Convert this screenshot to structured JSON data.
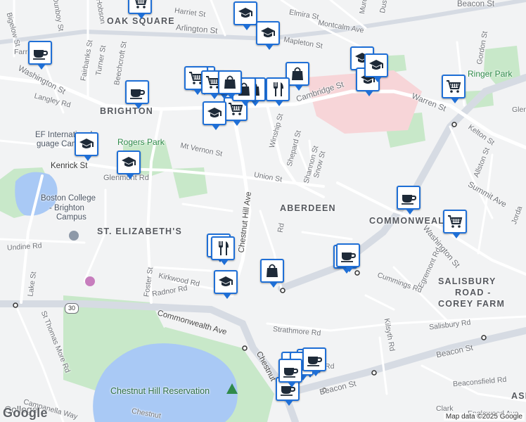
{
  "colors": {
    "marker_border": "#1f6fd6",
    "road": "#ffffff",
    "highway": "#d6dbe3",
    "park": "#c8e8c9",
    "water": "#a9c9f5",
    "hospital": "#f7d5d8"
  },
  "neighborhoods": [
    {
      "text": "OAK SQUARE"
    },
    {
      "text": "BRIGHTON"
    },
    {
      "text": "ST. ELIZABETH'S"
    },
    {
      "text": "ABERDEEN"
    },
    {
      "text": "COMMONWEALTH"
    },
    {
      "text": "SALISBURY"
    },
    {
      "text": "ROAD -"
    },
    {
      "text": "COREY FARM"
    },
    {
      "text": "ASH"
    }
  ],
  "parks": [
    {
      "text": "Rogers Park"
    },
    {
      "text": "Ringer Park"
    },
    {
      "text": "Chestnut Hill Reservation"
    }
  ],
  "pois": [
    {
      "text": "EF International"
    },
    {
      "text": "guage Campus"
    },
    {
      "text": "Boston College"
    },
    {
      "text": "- Brighton"
    },
    {
      "text": "Campus"
    },
    {
      "text": "College"
    }
  ],
  "streets": [
    {
      "text": "Harriet St"
    },
    {
      "text": "Arlington St"
    },
    {
      "text": "Elmira St"
    },
    {
      "text": "Montcalm Ave"
    },
    {
      "text": "Mapleton St"
    },
    {
      "text": "Bigelow St"
    },
    {
      "text": "Dunboy St"
    },
    {
      "text": "Hobson"
    },
    {
      "text": "Fairbanks St"
    },
    {
      "text": "Turner St"
    },
    {
      "text": "Beechcroft St"
    },
    {
      "text": "Washington St"
    },
    {
      "text": "Langley Rd"
    },
    {
      "text": "Cambridge St"
    },
    {
      "text": "Warren St"
    },
    {
      "text": "Kelton St"
    },
    {
      "text": "Allston St"
    },
    {
      "text": "Summit Ave"
    },
    {
      "text": "Gordon St"
    },
    {
      "text": "Mt Vernon St"
    },
    {
      "text": "Kenrick St"
    },
    {
      "text": "Glenmont Rd"
    },
    {
      "text": "Winship St"
    },
    {
      "text": "Shepard St"
    },
    {
      "text": "Shannon St"
    },
    {
      "text": "Snow St"
    },
    {
      "text": "Union St"
    },
    {
      "text": "Chestnut Hill Ave"
    },
    {
      "text": "Undine Rd"
    },
    {
      "text": "Kirkwood Rd"
    },
    {
      "text": "Radnor Rd"
    },
    {
      "text": "Foster St"
    },
    {
      "text": "Lake St"
    },
    {
      "text": "Commonwealth Ave"
    },
    {
      "text": "St Thomas More Rd"
    },
    {
      "text": "Strathmore Rd"
    },
    {
      "text": "Salisbury Rd"
    },
    {
      "text": "Beacon St"
    },
    {
      "text": "Beaconsfield Rd"
    },
    {
      "text": "Campanella Way"
    },
    {
      "text": "Chestnut"
    },
    {
      "text": "Cummings Rd"
    },
    {
      "text": "Egremont Rd"
    },
    {
      "text": "Washington St"
    },
    {
      "text": "Kilsyth Rd"
    },
    {
      "text": "Chestnut"
    },
    {
      "text": "Englewood Ave"
    },
    {
      "text": "Beacon St"
    },
    {
      "text": "Farr"
    },
    {
      "text": "Glen"
    },
    {
      "text": "Jorda"
    },
    {
      "text": "Clark"
    },
    {
      "text": "Rd"
    },
    {
      "text": "Murd"
    },
    {
      "text": "Dust"
    },
    {
      "text": "Rd"
    }
  ],
  "route_shield": "30",
  "markers": [
    {
      "icon": "school",
      "label": "school-marker"
    },
    {
      "icon": "cart",
      "label": "grocery-marker"
    },
    {
      "icon": "school",
      "label": "school-marker"
    },
    {
      "icon": "school",
      "label": "school-marker"
    },
    {
      "icon": "coffee",
      "label": "cafe-marker"
    },
    {
      "icon": "coffee",
      "label": "cafe-marker"
    },
    {
      "icon": "school",
      "label": "school-marker"
    },
    {
      "icon": "school",
      "label": "school-marker"
    },
    {
      "icon": "coffee",
      "label": "cafe-marker"
    },
    {
      "icon": "cart",
      "label": "grocery-marker"
    },
    {
      "icon": "cart",
      "label": "grocery-marker"
    },
    {
      "icon": "cart",
      "label": "grocery-marker"
    },
    {
      "icon": "bag",
      "label": "shop-marker"
    },
    {
      "icon": "bag",
      "label": "shop-marker"
    },
    {
      "icon": "fork",
      "label": "restaurant-marker"
    },
    {
      "icon": "bag",
      "label": "shop-marker"
    },
    {
      "icon": "school",
      "label": "school-marker"
    },
    {
      "icon": "cart",
      "label": "grocery-marker"
    },
    {
      "icon": "school",
      "label": "school-marker"
    },
    {
      "icon": "school",
      "label": "school-marker"
    },
    {
      "icon": "school",
      "label": "school-marker"
    },
    {
      "icon": "cart",
      "label": "grocery-marker"
    },
    {
      "icon": "coffee",
      "label": "cafe-marker"
    },
    {
      "icon": "cart",
      "label": "grocery-marker"
    },
    {
      "icon": "bag",
      "label": "shop-marker"
    },
    {
      "icon": "fork",
      "label": "restaurant-marker"
    },
    {
      "icon": "fork",
      "label": "restaurant-marker"
    },
    {
      "icon": "bag",
      "label": "shop-marker"
    },
    {
      "icon": "school",
      "label": "school-marker"
    },
    {
      "icon": "coffee",
      "label": "cafe-marker"
    },
    {
      "icon": "coffee",
      "label": "cafe-marker"
    },
    {
      "icon": "coffee",
      "label": "cafe-marker"
    },
    {
      "icon": "coffee",
      "label": "cafe-marker"
    },
    {
      "icon": "coffee",
      "label": "cafe-marker"
    },
    {
      "icon": "coffee",
      "label": "cafe-marker"
    },
    {
      "icon": "coffee",
      "label": "cafe-marker"
    }
  ],
  "footer": {
    "logo": "Google",
    "copyright": "Map data ©2025 Google"
  }
}
